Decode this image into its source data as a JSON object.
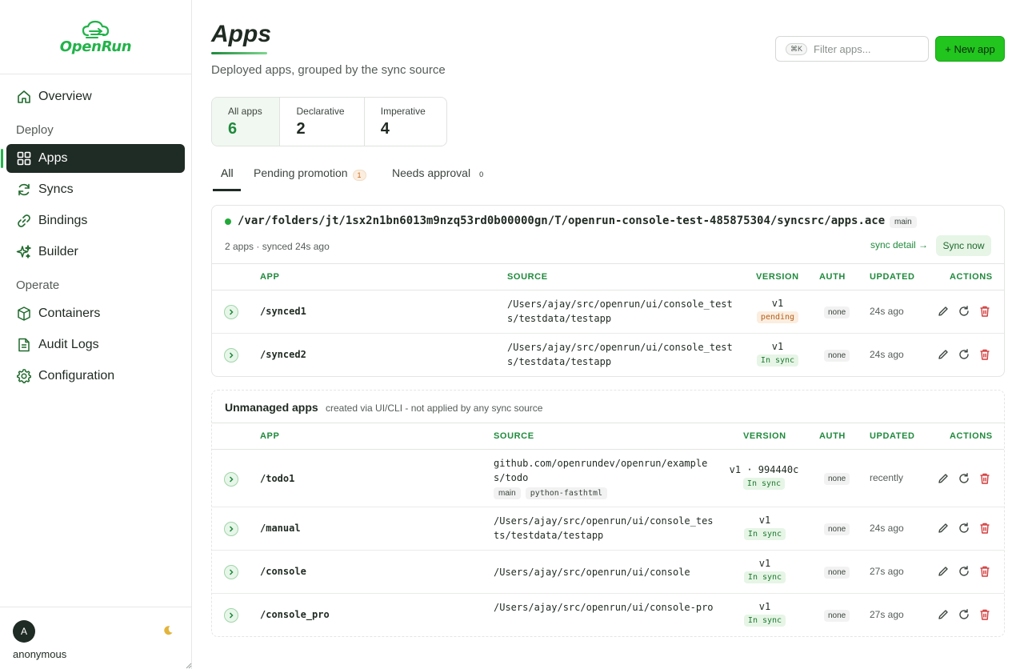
{
  "brand": {
    "name": "OpenRun"
  },
  "nav": {
    "overview": "Overview",
    "section_deploy": "Deploy",
    "apps": "Apps",
    "syncs": "Syncs",
    "bindings": "Bindings",
    "builder": "Builder",
    "section_operate": "Operate",
    "containers": "Containers",
    "audit_logs": "Audit Logs",
    "configuration": "Configuration"
  },
  "user": {
    "initial": "A",
    "name": "anonymous",
    "theme_icon": "moon-icon"
  },
  "header": {
    "title": "Apps",
    "subtitle": "Deployed apps, grouped by the sync source",
    "filter_shortcut": "⌘K",
    "filter_placeholder": "Filter apps...",
    "new_app_label": "+ New app"
  },
  "stats": [
    {
      "label": "All apps",
      "value": "6"
    },
    {
      "label": "Declarative",
      "value": "2"
    },
    {
      "label": "Imperative",
      "value": "4"
    }
  ],
  "tabs": [
    {
      "label": "All",
      "count": ""
    },
    {
      "label": "Pending promotion",
      "count": "1"
    },
    {
      "label": "Needs approval",
      "count": "0"
    }
  ],
  "columns": {
    "app": "APP",
    "source": "SOURCE",
    "version": "VERSION",
    "auth": "AUTH",
    "updated": "UPDATED",
    "actions": "ACTIONS"
  },
  "sync_group": {
    "path": "/var/folders/jt/1sx2n1bn6013m9nzq53rd0b00000gn/T/openrun-console-test-485875304/syncsrc/apps.ace",
    "branch": "main",
    "meta": "2 apps · synced 24s ago",
    "sync_detail": "sync detail →",
    "sync_now": "Sync now",
    "status_color": "#22a83a",
    "apps": [
      {
        "name": "/synced1",
        "source": "/Users/ajay/src/openrun/ui/console_tests/testdata/testapp",
        "version": "v1",
        "status": "pending",
        "auth": "none",
        "updated": "24s ago"
      },
      {
        "name": "/synced2",
        "source": "/Users/ajay/src/openrun/ui/console_tests/testdata/testapp",
        "version": "v1",
        "status": "In sync",
        "auth": "none",
        "updated": "24s ago"
      }
    ]
  },
  "unmanaged": {
    "title": "Unmanaged apps",
    "subtitle": "created via UI/CLI - not applied by any sync source",
    "apps": [
      {
        "name": "/todo1",
        "source": "github.com/openrundev/openrun/examples/todo",
        "tags": [
          "main",
          "python-fasthtml"
        ],
        "version": "v1 · 994440c",
        "status": "In sync",
        "auth": "none",
        "updated": "recently"
      },
      {
        "name": "/manual",
        "source": "/Users/ajay/src/openrun/ui/console_tests/testdata/testapp",
        "version": "v1",
        "status": "In sync",
        "auth": "none",
        "updated": "24s ago"
      },
      {
        "name": "/console",
        "source": "/Users/ajay/src/openrun/ui/console",
        "version": "v1",
        "status": "In sync",
        "auth": "none",
        "updated": "27s ago"
      },
      {
        "name": "/console_pro",
        "source": "/Users/ajay/src/openrun/ui/console-pro",
        "version": "v1",
        "status": "In sync",
        "auth": "none",
        "updated": "27s ago"
      }
    ]
  },
  "colors": {
    "accent": "#22c41e",
    "brand": "#22b34a",
    "sidebar_active": "#1f2b25",
    "header_text": "#1f8a3c",
    "pending": "#b5601a"
  }
}
